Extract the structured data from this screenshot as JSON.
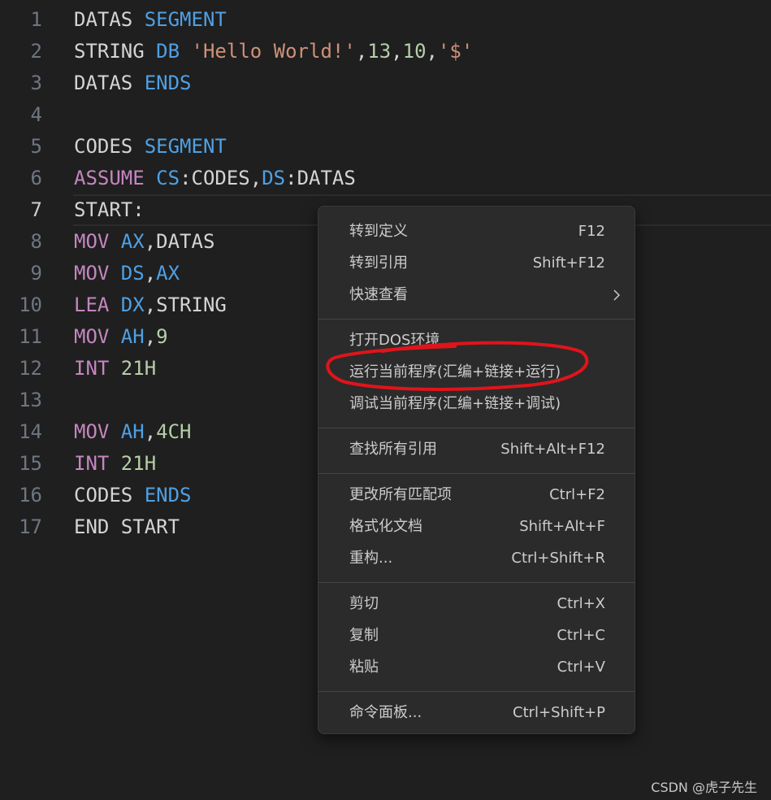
{
  "code_lines": [
    {
      "num": "1",
      "tokens": [
        {
          "t": "DATAS ",
          "c": "id"
        },
        {
          "t": "SEGMENT",
          "c": "kw"
        }
      ]
    },
    {
      "num": "2",
      "tokens": [
        {
          "t": "STRING ",
          "c": "id"
        },
        {
          "t": "DB ",
          "c": "kw"
        },
        {
          "t": "'Hello World!'",
          "c": "str"
        },
        {
          "t": ",",
          "c": "pun"
        },
        {
          "t": "13",
          "c": "num"
        },
        {
          "t": ",",
          "c": "pun"
        },
        {
          "t": "10",
          "c": "num"
        },
        {
          "t": ",",
          "c": "pun"
        },
        {
          "t": "'$'",
          "c": "str"
        }
      ]
    },
    {
      "num": "3",
      "tokens": [
        {
          "t": "DATAS ",
          "c": "id"
        },
        {
          "t": "ENDS",
          "c": "kw"
        }
      ]
    },
    {
      "num": "4",
      "tokens": []
    },
    {
      "num": "5",
      "tokens": [
        {
          "t": "CODES ",
          "c": "id"
        },
        {
          "t": "SEGMENT",
          "c": "kw"
        }
      ]
    },
    {
      "num": "6",
      "tokens": [
        {
          "t": "ASSUME ",
          "c": "ins"
        },
        {
          "t": "CS",
          "c": "kw"
        },
        {
          "t": ":CODES,",
          "c": "id"
        },
        {
          "t": "DS",
          "c": "kw"
        },
        {
          "t": ":DATAS",
          "c": "id"
        }
      ]
    },
    {
      "num": "7",
      "tokens": [
        {
          "t": "START:",
          "c": "id"
        }
      ],
      "current": true
    },
    {
      "num": "8",
      "tokens": [
        {
          "t": "MOV ",
          "c": "ins"
        },
        {
          "t": "AX",
          "c": "kw"
        },
        {
          "t": ",DATAS",
          "c": "id"
        }
      ]
    },
    {
      "num": "9",
      "tokens": [
        {
          "t": "MOV ",
          "c": "ins"
        },
        {
          "t": "DS",
          "c": "kw"
        },
        {
          "t": ",",
          "c": "pun"
        },
        {
          "t": "AX",
          "c": "kw"
        }
      ]
    },
    {
      "num": "10",
      "tokens": [
        {
          "t": "LEA ",
          "c": "ins"
        },
        {
          "t": "DX",
          "c": "kw"
        },
        {
          "t": ",STRING",
          "c": "id"
        }
      ]
    },
    {
      "num": "11",
      "tokens": [
        {
          "t": "MOV ",
          "c": "ins"
        },
        {
          "t": "AH",
          "c": "kw"
        },
        {
          "t": ",",
          "c": "pun"
        },
        {
          "t": "9",
          "c": "num"
        }
      ]
    },
    {
      "num": "12",
      "tokens": [
        {
          "t": "INT ",
          "c": "ins"
        },
        {
          "t": "21H",
          "c": "num"
        }
      ]
    },
    {
      "num": "13",
      "tokens": []
    },
    {
      "num": "14",
      "tokens": [
        {
          "t": "MOV ",
          "c": "ins"
        },
        {
          "t": "AH",
          "c": "kw"
        },
        {
          "t": ",",
          "c": "pun"
        },
        {
          "t": "4CH",
          "c": "num"
        }
      ]
    },
    {
      "num": "15",
      "tokens": [
        {
          "t": "INT ",
          "c": "ins"
        },
        {
          "t": "21H",
          "c": "num"
        }
      ]
    },
    {
      "num": "16",
      "tokens": [
        {
          "t": "CODES ",
          "c": "id"
        },
        {
          "t": "ENDS",
          "c": "kw"
        }
      ]
    },
    {
      "num": "17",
      "tokens": [
        {
          "t": "END START",
          "c": "id"
        }
      ]
    }
  ],
  "context_menu": {
    "groups": [
      [
        {
          "label": "转到定义",
          "key": "F12"
        },
        {
          "label": "转到引用",
          "key": "Shift+F12"
        },
        {
          "label": "快速查看",
          "key": "",
          "submenu": true
        }
      ],
      [
        {
          "label": "打开DOS环境",
          "key": ""
        },
        {
          "label": "运行当前程序(汇编+链接+运行)",
          "key": "",
          "highlighted": true
        },
        {
          "label": "调试当前程序(汇编+链接+调试)",
          "key": ""
        }
      ],
      [
        {
          "label": "查找所有引用",
          "key": "Shift+Alt+F12"
        }
      ],
      [
        {
          "label": "更改所有匹配项",
          "key": "Ctrl+F2"
        },
        {
          "label": "格式化文档",
          "key": "Shift+Alt+F"
        },
        {
          "label": "重构...",
          "key": "Ctrl+Shift+R"
        }
      ],
      [
        {
          "label": "剪切",
          "key": "Ctrl+X"
        },
        {
          "label": "复制",
          "key": "Ctrl+C"
        },
        {
          "label": "粘贴",
          "key": "Ctrl+V"
        }
      ],
      [
        {
          "label": "命令面板...",
          "key": "Ctrl+Shift+P"
        }
      ]
    ]
  },
  "annotation_color": "#e0141b",
  "watermark": "CSDN @虎子先生",
  "icons": {
    "submenu": "chevron-right-icon"
  }
}
